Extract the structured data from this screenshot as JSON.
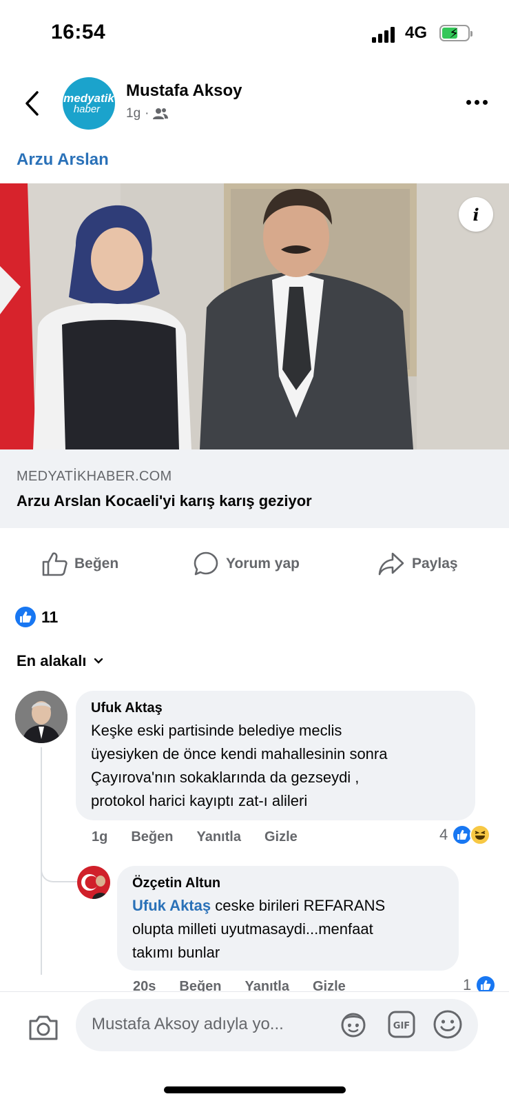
{
  "status_bar": {
    "time": "16:54",
    "network": "4G",
    "battery_charging": true
  },
  "post": {
    "page_avatar": {
      "line1": "medyatik",
      "line2": "haber"
    },
    "author": "Mustafa Aksoy",
    "time": "1g",
    "audience_icon": "friends-icon",
    "tagged_name": "Arzu Arslan",
    "link_domain": "MEDYATİKHABER.COM",
    "link_title": "Arzu Arslan Kocaeli'yi karış karış geziyor"
  },
  "actions": {
    "like": "Beğen",
    "comment": "Yorum yap",
    "share": "Paylaş"
  },
  "reactions": {
    "count": "11"
  },
  "sort_label": "En alakalı",
  "comments": [
    {
      "name": "Ufuk Aktaş",
      "lines": [
        "Keşke eski partisinde belediye meclis",
        "üyesiyken de önce kendi mahallesinin sonra",
        "Çayırova'nın sokaklarında da gezseydi ,",
        "protokol harici kayıptı zat-ı alileri"
      ],
      "time": "1g",
      "like": "Beğen",
      "reply": "Yanıtla",
      "hide": "Gizle",
      "reaction_count": "4"
    },
    {
      "name": "Özçetin Altun",
      "mention": "Ufuk Aktaş",
      "line1_rest": " ceske birileri REFARANS",
      "line2": "olupta milleti uyutmasaydi...menfaat",
      "line3": "takımı bunlar",
      "time": "20s",
      "like": "Beğen",
      "reply": "Yanıtla",
      "hide": "Gizle",
      "reaction_count": "1"
    }
  ],
  "composer": {
    "placeholder": "Mustafa Aksoy adıyla yo..."
  },
  "colors": {
    "accent": "#1877f2",
    "link": "#2a71b8",
    "secondary_text": "#65676b",
    "bubble": "#f0f2f5"
  }
}
